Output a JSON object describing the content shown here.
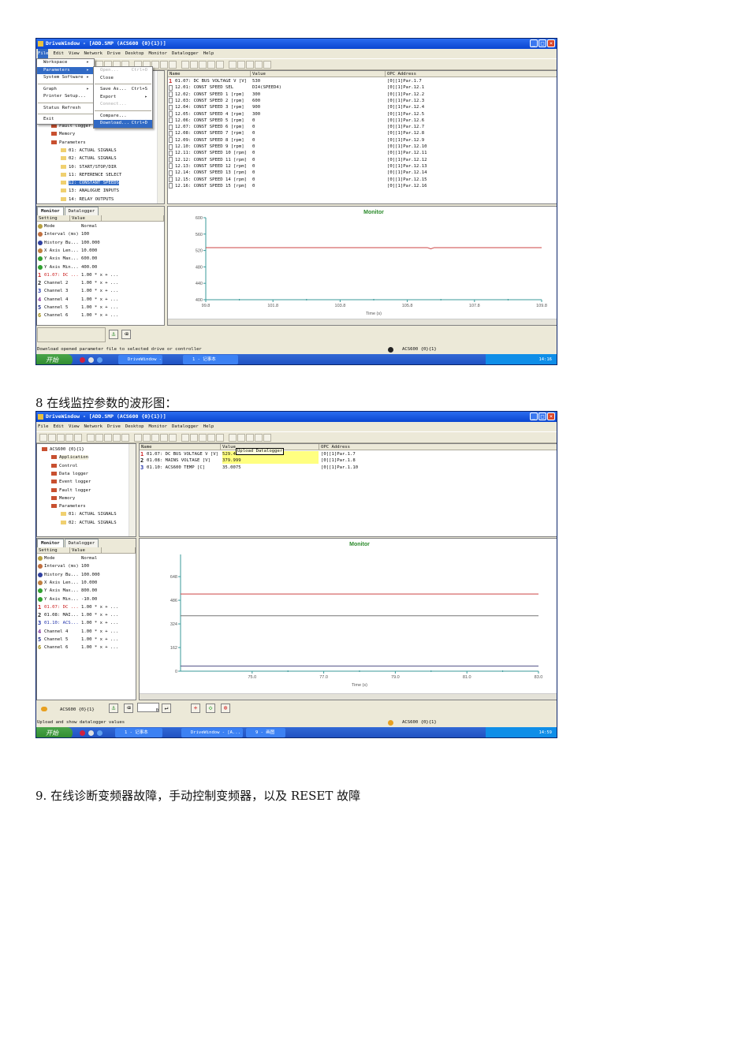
{
  "doc": {
    "heading8": "8 在线监控参数的波形图：",
    "heading9": "9. 在线诊断变频器故障，手动控制变频器，以及 RESET 故障"
  },
  "win1": {
    "title": "DriveWindow - [ADD.SMP (ACS600 {0}{1})]",
    "menu": [
      "File",
      "Edit",
      "View",
      "Network",
      "Drive",
      "Desktop",
      "Monitor",
      "Datalogger",
      "Help"
    ],
    "file_menu": [
      {
        "label": "Workspace",
        "arrow": true
      },
      {
        "label": "Parameters",
        "arrow": true,
        "hl": true
      },
      {
        "label": "System Software",
        "arrow": true
      },
      {
        "sep": true
      },
      {
        "label": "Graph",
        "arrow": true
      },
      {
        "label": "Printer Setup..."
      },
      {
        "sep": true
      },
      {
        "label": "Status Refresh"
      },
      {
        "sep": true
      },
      {
        "label": "Exit"
      }
    ],
    "param_menu": [
      {
        "label": "Open...",
        "sc": "Ctrl+O",
        "dis": true
      },
      {
        "label": "Close"
      },
      {
        "sep": true
      },
      {
        "label": "Save As...",
        "sc": "Ctrl+S"
      },
      {
        "label": "Export",
        "arrow": true
      },
      {
        "label": "Connect...",
        "dis": true
      },
      {
        "sep": true
      },
      {
        "label": "Compare..."
      },
      {
        "label": "Download...",
        "sc": "Ctrl+D",
        "hl": true
      }
    ],
    "tree": [
      {
        "label": "Fault logger",
        "lvl": 1
      },
      {
        "label": "Memory",
        "lvl": 1
      },
      {
        "label": "Parameters",
        "lvl": 1
      },
      {
        "label": "01: ACTUAL SIGNALS",
        "lvl": 2
      },
      {
        "label": "02: ACTUAL SIGNALS",
        "lvl": 2
      },
      {
        "label": "10: START/STOP/DIR",
        "lvl": 2
      },
      {
        "label": "11: REFERENCE SELECT",
        "lvl": 2
      },
      {
        "label": "12: CONSTANT SPEEDS",
        "lvl": 2,
        "sel": true
      },
      {
        "label": "13: ANALOGUE INPUTS",
        "lvl": 2
      },
      {
        "label": "14: RELAY OUTPUTS",
        "lvl": 2
      }
    ],
    "list_headers": [
      "Name",
      "Value",
      "OPC Address"
    ],
    "rows": [
      [
        "1",
        "01.07: DC BUS VOLTAGE V [V]",
        "530",
        "[0][1]Par.1.7"
      ],
      [
        "",
        "12.01: CONST SPEED SEL",
        "DI4(SPEED4)",
        "[0][1]Par.12.1"
      ],
      [
        "",
        "12.02: CONST SPEED 1 [rpm]",
        "300",
        "[0][1]Par.12.2"
      ],
      [
        "",
        "12.03: CONST SPEED 2 [rpm]",
        "600",
        "[0][1]Par.12.3"
      ],
      [
        "",
        "12.04: CONST SPEED 3 [rpm]",
        "900",
        "[0][1]Par.12.4"
      ],
      [
        "",
        "12.05: CONST SPEED 4 [rpm]",
        "300",
        "[0][1]Par.12.5"
      ],
      [
        "",
        "12.06: CONST SPEED 5 [rpm]",
        "0",
        "[0][1]Par.12.6"
      ],
      [
        "",
        "12.07: CONST SPEED 6 [rpm]",
        "0",
        "[0][1]Par.12.7"
      ],
      [
        "",
        "12.08: CONST SPEED 7 [rpm]",
        "0",
        "[0][1]Par.12.8"
      ],
      [
        "",
        "12.09: CONST SPEED 8 [rpm]",
        "0",
        "[0][1]Par.12.9"
      ],
      [
        "",
        "12.10: CONST SPEED 9 [rpm]",
        "0",
        "[0][1]Par.12.10"
      ],
      [
        "",
        "12.11: CONST SPEED 10 [rpm]",
        "0",
        "[0][1]Par.12.11"
      ],
      [
        "",
        "12.12: CONST SPEED 11 [rpm]",
        "0",
        "[0][1]Par.12.12"
      ],
      [
        "",
        "12.13: CONST SPEED 12 [rpm]",
        "0",
        "[0][1]Par.12.13"
      ],
      [
        "",
        "12.14: CONST SPEED 13 [rpm]",
        "0",
        "[0][1]Par.12.14"
      ],
      [
        "",
        "12.15: CONST SPEED 14 [rpm]",
        "0",
        "[0][1]Par.12.15"
      ],
      [
        "",
        "12.16: CONST SPEED 15 [rpm]",
        "0",
        "[0][1]Par.12.16"
      ]
    ],
    "monitor_tabs": [
      "Monitor",
      "Datalogger"
    ],
    "monitor_headers": [
      "Setting",
      "Value"
    ],
    "monitor_rows": [
      [
        "",
        "Mode",
        "Normal"
      ],
      [
        "",
        "Interval (ms)",
        "100"
      ],
      [
        "",
        "History Bu...",
        "100.000"
      ],
      [
        "",
        "X Axis Len...",
        "10.000"
      ],
      [
        "",
        "Y Axis Max...",
        "600.00"
      ],
      [
        "",
        "Y Axis Min...",
        "400.00"
      ],
      [
        "1",
        "01.07: DC ...",
        "1.00 * x + ..."
      ],
      [
        "2",
        "Channel 2",
        "1.00 * x + ..."
      ],
      [
        "3",
        "Channel 3",
        "1.00 * x + ..."
      ],
      [
        "4",
        "Channel 4",
        "1.00 * x + ..."
      ],
      [
        "5",
        "Channel 5",
        "1.00 * x + ..."
      ],
      [
        "6",
        "Channel 6",
        "1.00 * x + ..."
      ]
    ],
    "status": "Download opened parameter file to selected drive or controller",
    "status_drive": "ACS600 {0}{1}",
    "taskbar": {
      "start": "开始",
      "items": [
        "DriveWindow - [A...",
        "1 - 记事本"
      ],
      "clock": "14:16"
    }
  },
  "win2": {
    "title": "DriveWindow - [ADD.SMP (ACS600 {0}{1})]",
    "menu": [
      "File",
      "Edit",
      "View",
      "Network",
      "Drive",
      "Desktop",
      "Monitor",
      "Datalogger",
      "Help"
    ],
    "tree": [
      {
        "label": "ACS600 {0}{1}",
        "lvl": 0
      },
      {
        "label": "Application",
        "lvl": 1,
        "hot": true
      },
      {
        "label": "Control",
        "lvl": 1
      },
      {
        "label": "Data logger",
        "lvl": 1
      },
      {
        "label": "Event logger",
        "lvl": 1
      },
      {
        "label": "Fault logger",
        "lvl": 1
      },
      {
        "label": "Memory",
        "lvl": 1
      },
      {
        "label": "Parameters",
        "lvl": 1
      },
      {
        "label": "01: ACTUAL SIGNALS",
        "lvl": 2
      },
      {
        "label": "02: ACTUAL SIGNALS",
        "lvl": 2
      }
    ],
    "list_headers": [
      "Name",
      "Value",
      "OPC Address"
    ],
    "tooltip": "Upload Datalogger",
    "rows": [
      [
        "1",
        "01.07: DC BUS VOLTAGE V [V]",
        "529.45",
        "[0][1]Par.1.7"
      ],
      [
        "2",
        "01.08: MAINS VOLTAGE [V]",
        "379.999",
        "[0][1]Par.1.8"
      ],
      [
        "3",
        "01.10: ACS600 TEMP [C]",
        "35.0075",
        "[0][1]Par.1.10"
      ]
    ],
    "monitor_tabs": [
      "Monitor",
      "Datalogger"
    ],
    "monitor_headers": [
      "Setting",
      "Value"
    ],
    "monitor_rows": [
      [
        "",
        "Mode",
        "Normal"
      ],
      [
        "",
        "Interval (ms)",
        "100"
      ],
      [
        "",
        "History Bu...",
        "100.000"
      ],
      [
        "",
        "X Axis Len...",
        "10.000"
      ],
      [
        "",
        "Y Axis Max...",
        "800.00"
      ],
      [
        "",
        "Y Axis Min...",
        "-10.00"
      ],
      [
        "1",
        "01.07: DC ...",
        "1.00 * x + ..."
      ],
      [
        "2",
        "01.08: MAI...",
        "1.00 * x + ..."
      ],
      [
        "3",
        "01.10: ACS...",
        "1.00 * x + ..."
      ],
      [
        "4",
        "Channel 4",
        "1.00 * x + ..."
      ],
      [
        "5",
        "Channel 5",
        "1.00 * x + ..."
      ],
      [
        "6",
        "Channel 6",
        "1.00 * x + ..."
      ]
    ],
    "drive_label": "ACS600 {0}{1}",
    "input_value": "0",
    "status": "Upload and show datalogger values",
    "status_drive": "ACS600 {0}{1}",
    "taskbar": {
      "start": "开始",
      "items": [
        "1 - 记事本",
        "DriveWindow - [A...",
        "9 - 画图"
      ],
      "clock": "14:59"
    }
  },
  "colors": {
    "ch1": "#cc2222",
    "ch2": "#111111",
    "ch3": "#2233aa",
    "ch4": "#7a2a9a",
    "ch5": "#1a2a8a",
    "ch6": "#a08a10",
    "title_green": "#2a8a2a",
    "axis": "#3a9a9a"
  },
  "chart_data": [
    {
      "type": "line",
      "title": "Monitor",
      "xlabel": "Time (s)",
      "ylabel": "",
      "xlim": [
        99.8,
        109.8
      ],
      "ylim": [
        400,
        600
      ],
      "xticks": [
        "99.8",
        "101.8",
        "103.8",
        "105.8",
        "107.8",
        "109.8"
      ],
      "yticks": [
        "400",
        "440",
        "480",
        "520",
        "560",
        "600"
      ],
      "series": [
        {
          "name": "01.07: DC BUS VOLTAGE V [V]",
          "color": "#cc4444",
          "x": [
            99.8,
            102,
            104,
            106.4,
            106.5,
            106.6,
            109.8
          ],
          "y": [
            527,
            527,
            527,
            527,
            524,
            527,
            527
          ]
        }
      ]
    },
    {
      "type": "line",
      "title": "Monitor",
      "xlabel": "Time (s)",
      "ylabel": "",
      "xlim": [
        73.0,
        83.0
      ],
      "ylim": [
        0,
        800
      ],
      "xticks": [
        "75.0",
        "77.0",
        "79.0",
        "81.0",
        "83.0"
      ],
      "yticks": [
        "0",
        "162",
        "324",
        "486",
        "648"
      ],
      "series": [
        {
          "name": "01.07: DC BUS VOLTAGE V [V]",
          "color": "#cc4444",
          "x": [
            73.0,
            83.0
          ],
          "y": [
            529,
            529
          ]
        },
        {
          "name": "01.08: MAINS VOLTAGE [V]",
          "color": "#777777",
          "x": [
            73.0,
            83.0
          ],
          "y": [
            380,
            380
          ]
        },
        {
          "name": "01.10: ACS600 TEMP [C]",
          "color": "#555588",
          "x": [
            73.0,
            83.0
          ],
          "y": [
            35,
            35
          ]
        }
      ]
    }
  ]
}
